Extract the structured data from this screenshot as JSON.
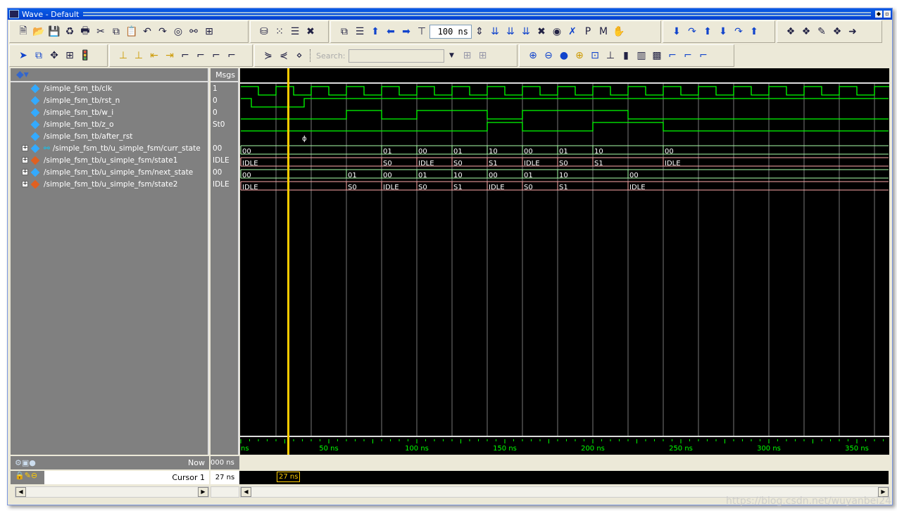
{
  "window": {
    "title": "Wave - Default"
  },
  "toolbar1": [
    "new-file",
    "open-folder",
    "save",
    "reload",
    "print",
    "cut",
    "copy",
    "paste",
    "undo",
    "redo",
    "find-circle",
    "binoculars",
    "expand-tree",
    "load-dataset",
    "dots-grid",
    "edit-list",
    "delete-x",
    "link",
    "insert-list",
    "arrow-up",
    "arrow-left",
    "arrow-right",
    "insert-break"
  ],
  "run_length": "100 ns",
  "toolbar1b": [
    "run",
    "run-continue",
    "run-all",
    "break",
    "restart",
    "step-x",
    "profile-p",
    "memory-m",
    "hand"
  ],
  "toolbar1c": [
    "step-down",
    "step-over",
    "step-up",
    "step-down-2",
    "step-over-2",
    "step-up-2"
  ],
  "toolbar1d": [
    "add-layout",
    "remove-layout",
    "edit-layout",
    "save-layout",
    "next-layout"
  ],
  "toolbar2": [
    "select-arrow",
    "zoom-box",
    "pan",
    "insert-divider",
    "traffic-light",
    "add-cursor",
    "remove-cursor",
    "prev-edge",
    "next-edge",
    "wave-1",
    "wave-2",
    "wave-3",
    "wave-4",
    "find-prev",
    "find-next",
    "find-expr"
  ],
  "search": {
    "label": "Search:",
    "value": ""
  },
  "toolbar2b": [
    "zoom-in",
    "zoom-out",
    "zoom-full",
    "zoom-cursor",
    "zoom-region",
    "wave-style-1",
    "wave-style-2",
    "wave-style-3",
    "pattern",
    "step-1",
    "step-2",
    "step-3"
  ],
  "columns": {
    "msgs": "Msgs"
  },
  "signals": [
    {
      "name": "/simple_fsm_tb/clk",
      "value": "1",
      "color": "#33aaff",
      "expand": false
    },
    {
      "name": "/simple_fsm_tb/rst_n",
      "value": "0",
      "color": "#33aaff",
      "expand": false
    },
    {
      "name": "/simple_fsm_tb/w_i",
      "value": "0",
      "color": "#33aaff",
      "expand": false
    },
    {
      "name": "/simple_fsm_tb/z_o",
      "value": "St0",
      "color": "#33aaff",
      "expand": false
    },
    {
      "name": "/simple_fsm_tb/after_rst",
      "value": "",
      "color": "#33aaff",
      "expand": false
    },
    {
      "name": "/simple_fsm_tb/u_simple_fsm/curr_state",
      "value": "00",
      "color": "#33aaff",
      "expand": true,
      "fsm": true
    },
    {
      "name": "/simple_fsm_tb/u_simple_fsm/state1",
      "value": "IDLE",
      "color": "#e06020",
      "expand": true
    },
    {
      "name": "/simple_fsm_tb/u_simple_fsm/next_state",
      "value": "00",
      "color": "#33aaff",
      "expand": true
    },
    {
      "name": "/simple_fsm_tb/u_simple_fsm/state2",
      "value": "IDLE",
      "color": "#e06020",
      "expand": true
    }
  ],
  "chart_data": {
    "type": "waveform",
    "time_unit": "ns",
    "xlim": [
      0,
      368
    ],
    "ticks": [
      50,
      100,
      150,
      200,
      250,
      300,
      350
    ],
    "grid_period": 20,
    "colors": {
      "logic": "#00ff00",
      "bus": "#aaffaa",
      "enum": "#ffaaaa",
      "cursor": "#ffcc00",
      "tick": "#00ff00"
    },
    "digital": [
      {
        "signal": "clk",
        "clock": {
          "period": 20,
          "high": 10
        }
      },
      {
        "signal": "rst_n",
        "edges": [
          [
            0,
            1
          ],
          [
            6,
            0
          ],
          [
            36,
            1
          ]
        ]
      },
      {
        "signal": "w_i",
        "edges": [
          [
            0,
            0
          ],
          [
            60,
            1
          ],
          [
            80,
            0
          ],
          [
            100,
            1
          ],
          [
            140,
            0
          ],
          [
            160,
            1
          ],
          [
            220,
            0
          ]
        ]
      },
      {
        "signal": "z_o",
        "edges": [
          [
            0,
            0
          ],
          [
            140,
            1
          ],
          [
            160,
            0
          ],
          [
            200,
            1
          ],
          [
            240,
            0
          ]
        ]
      }
    ],
    "events": [
      {
        "signal": "after_rst",
        "time": 36
      }
    ],
    "buses": [
      {
        "signal": "curr_state",
        "kind": "bus",
        "changes": [
          [
            0,
            "00"
          ],
          [
            80,
            "01"
          ],
          [
            100,
            "00"
          ],
          [
            120,
            "01"
          ],
          [
            140,
            "10"
          ],
          [
            160,
            "00"
          ],
          [
            180,
            "01"
          ],
          [
            200,
            "10"
          ],
          [
            240,
            "00"
          ]
        ]
      },
      {
        "signal": "state1",
        "kind": "enum",
        "changes": [
          [
            0,
            "IDLE"
          ],
          [
            80,
            "S0"
          ],
          [
            100,
            "IDLE"
          ],
          [
            120,
            "S0"
          ],
          [
            140,
            "S1"
          ],
          [
            160,
            "IDLE"
          ],
          [
            180,
            "S0"
          ],
          [
            200,
            "S1"
          ],
          [
            240,
            "IDLE"
          ]
        ]
      },
      {
        "signal": "next_state",
        "kind": "bus",
        "changes": [
          [
            0,
            "00"
          ],
          [
            60,
            "01"
          ],
          [
            80,
            "00"
          ],
          [
            100,
            "01"
          ],
          [
            120,
            "10"
          ],
          [
            140,
            "00"
          ],
          [
            160,
            "01"
          ],
          [
            180,
            "10"
          ],
          [
            220,
            "00"
          ]
        ]
      },
      {
        "signal": "state2",
        "kind": "enum",
        "changes": [
          [
            0,
            "IDLE"
          ],
          [
            60,
            "S0"
          ],
          [
            80,
            "IDLE"
          ],
          [
            100,
            "S0"
          ],
          [
            120,
            "S1"
          ],
          [
            140,
            "IDLE"
          ],
          [
            160,
            "S0"
          ],
          [
            180,
            "S1"
          ],
          [
            220,
            "IDLE"
          ]
        ]
      }
    ],
    "cursor": 27
  },
  "footer": {
    "now_label": "Now",
    "now_value": "000 ns",
    "cursor_label": "Cursor 1",
    "cursor_value": "27 ns",
    "cursor_tag": "27 ns",
    "first_tick_fragment": "ns"
  },
  "watermark": "https://blog.csdn.net/wuyanbei24"
}
